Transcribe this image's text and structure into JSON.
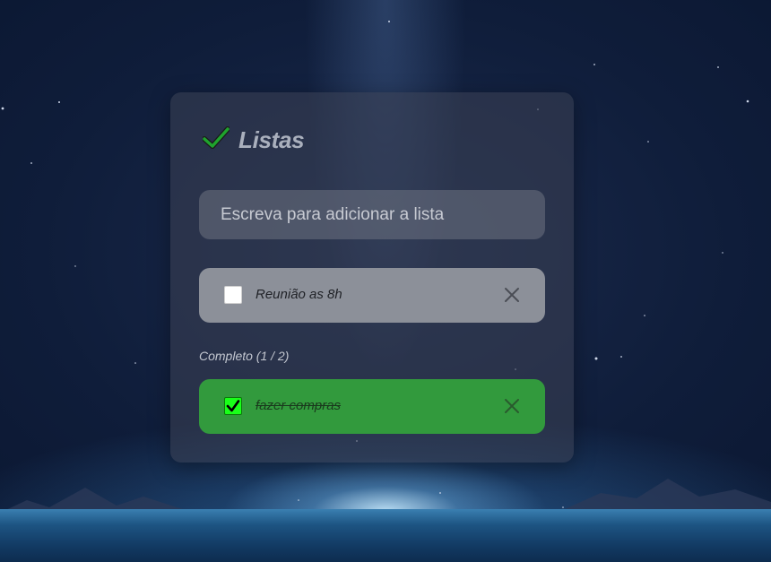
{
  "app": {
    "title": "Listas"
  },
  "new_item": {
    "placeholder": "Escreva para adicionar a lista",
    "value": ""
  },
  "pending_items": [
    {
      "label": "Reunião as 8h",
      "checked": false
    }
  ],
  "completed_section": {
    "label": "Completo (1 / 2)"
  },
  "completed_items": [
    {
      "label": "fazer compras",
      "checked": true
    }
  ],
  "colors": {
    "accent_check": "#1fa32e",
    "pending_item_bg": "#8c9099",
    "completed_item_bg": "#329a3d",
    "checkbox_checked": "#19ff19"
  },
  "icons": {
    "title": "checkmark-icon",
    "delete": "close-icon",
    "checkbox_checked": "check-icon"
  }
}
